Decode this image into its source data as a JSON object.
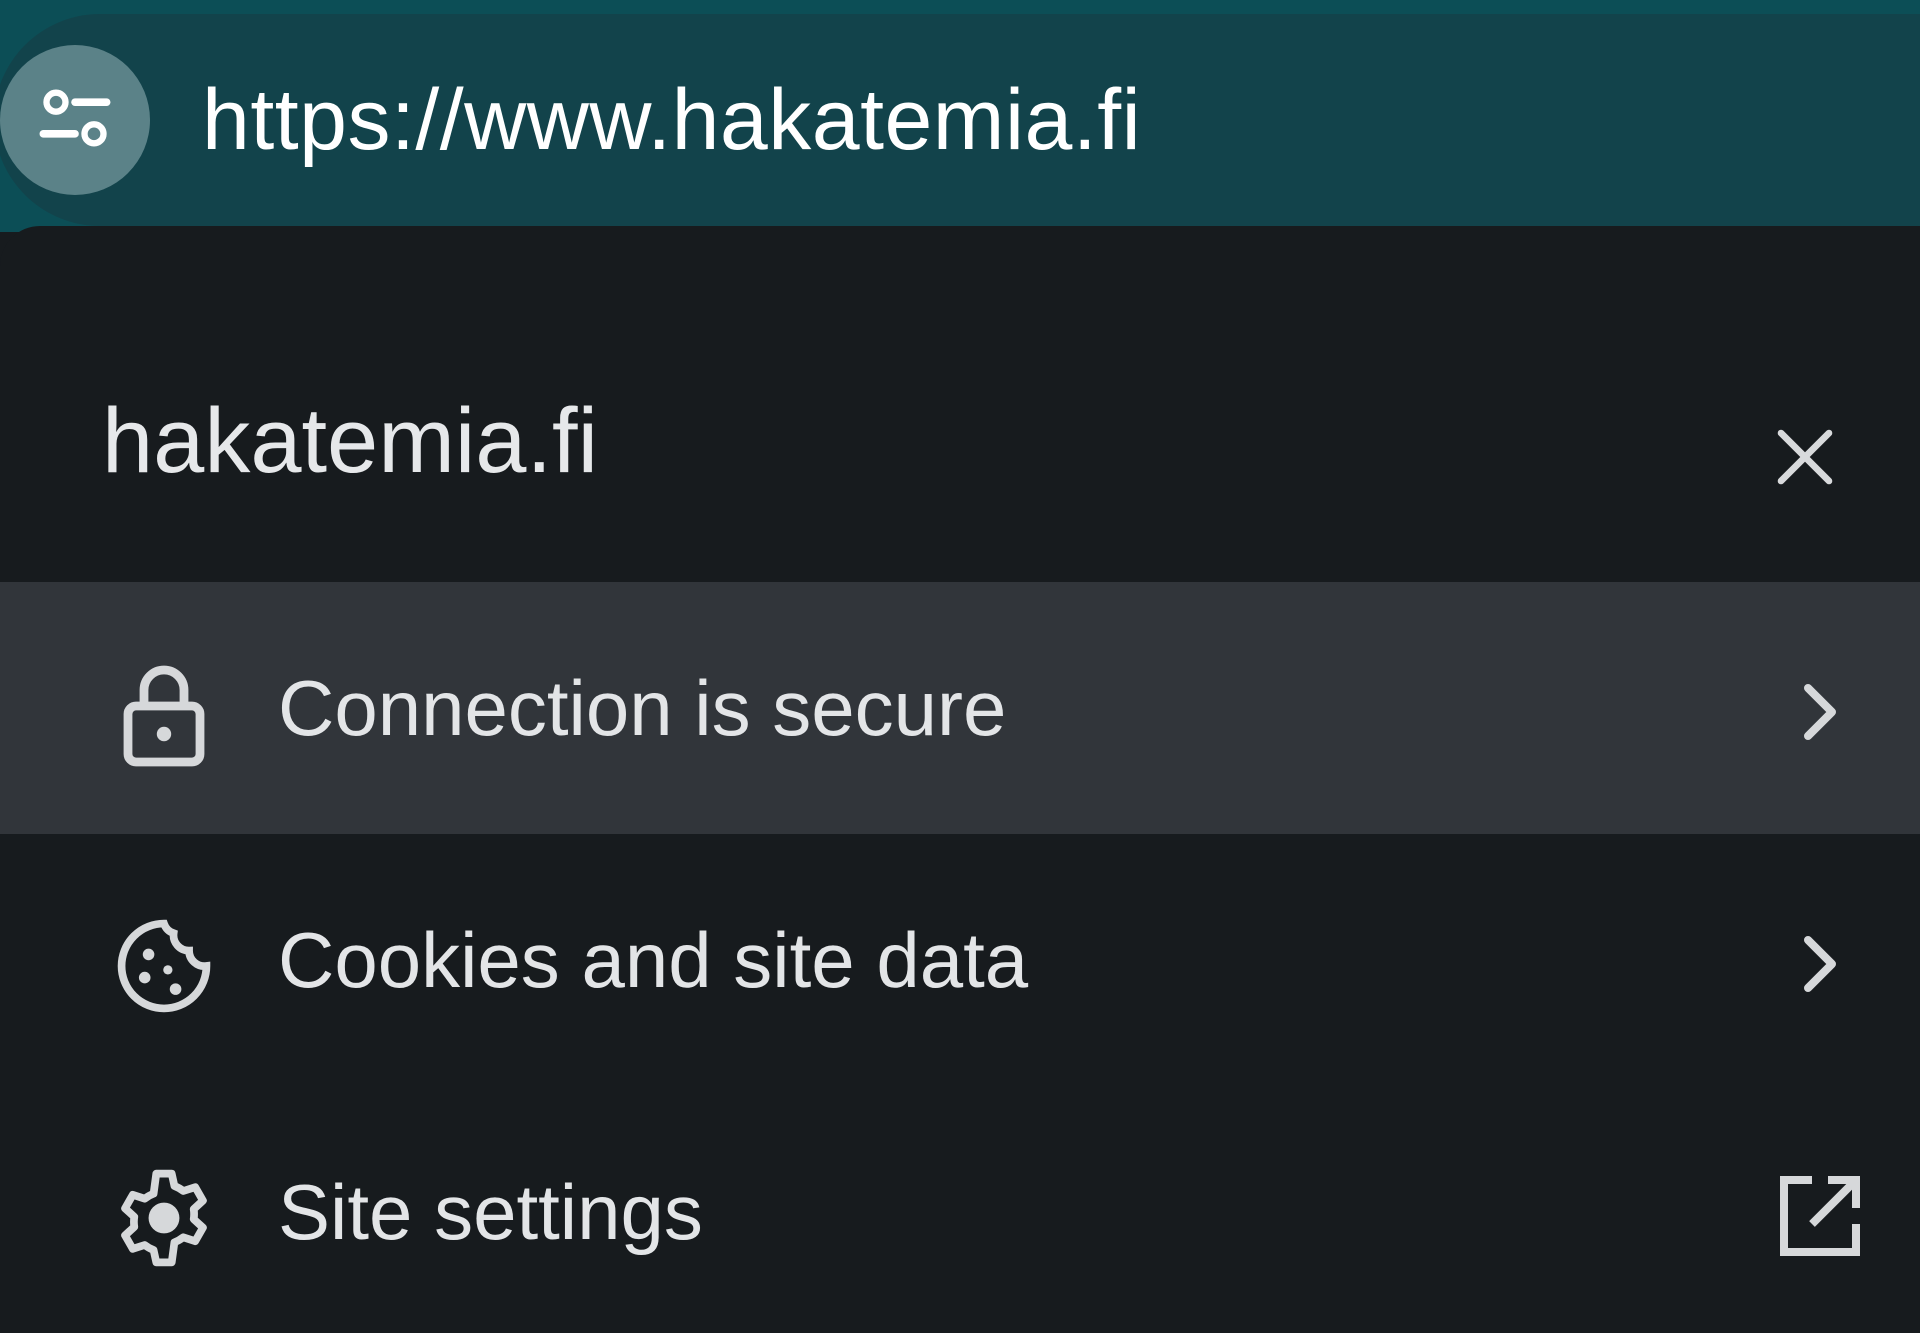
{
  "omnibox": {
    "url": "https://www.hakatemia.fi",
    "site_controls_icon": "tune-icon"
  },
  "site_info_panel": {
    "title": "hakatemia.fi",
    "close_icon": "close-icon",
    "items": [
      {
        "label": "Connection is secure",
        "icon": "lock-icon",
        "trailing_icon": "chevron-right-icon",
        "highlighted": true
      },
      {
        "label": "Cookies and site data",
        "icon": "cookie-icon",
        "trailing_icon": "chevron-right-icon",
        "highlighted": false
      },
      {
        "label": "Site settings",
        "icon": "gear-icon",
        "trailing_icon": "open-in-new-icon",
        "highlighted": false
      }
    ]
  },
  "colors": {
    "toolbar": "#0c4e56",
    "omnibox": "#12434b",
    "panel_background": "#171b1e",
    "highlight_row": "#31353a",
    "text": "#e3e5e7"
  }
}
